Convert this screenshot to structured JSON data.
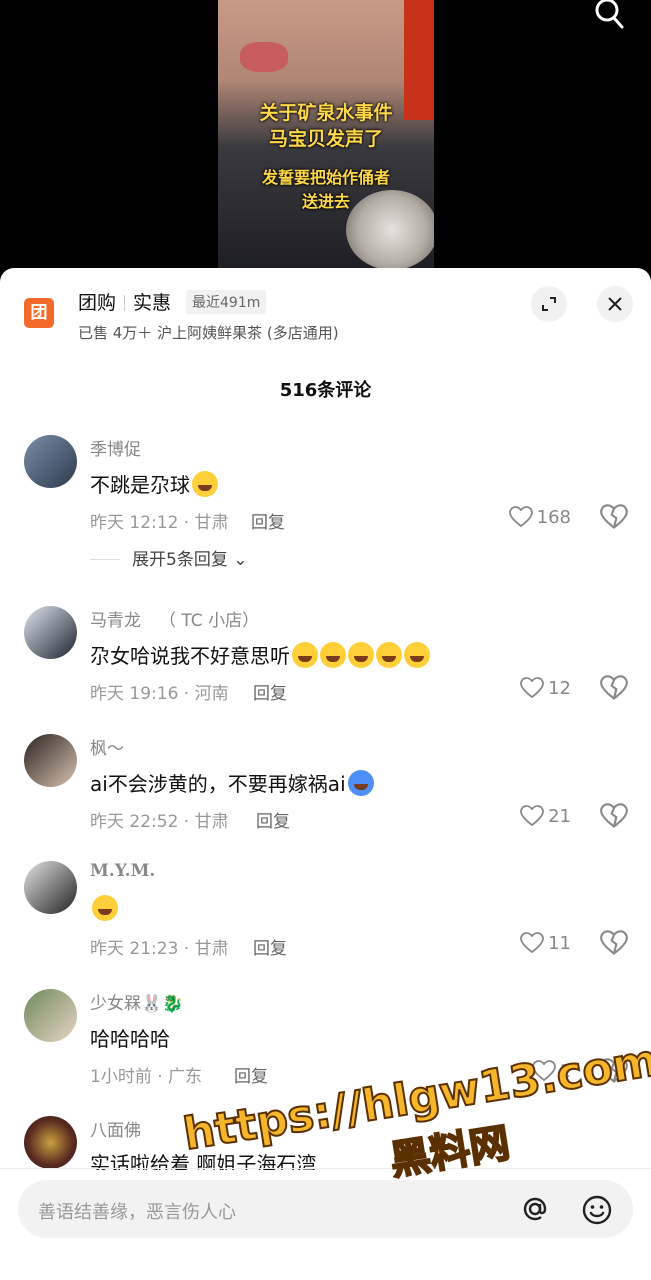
{
  "video": {
    "caption_line1": "关于矿泉水事件",
    "caption_line2": "马宝贝发声了",
    "caption_line3": "发誓要把始作俑者",
    "caption_line4": "送进去"
  },
  "groupbuy": {
    "logo": "团",
    "label1": "团购",
    "label2": "实惠",
    "distance": "最近491m",
    "subtitle": "已售 4万＋ 沪上阿姨鲜果茶 (多店通用)"
  },
  "comments_count": "516条评论",
  "reply_label": "回复",
  "comments": [
    {
      "user": "季博促",
      "tag": "",
      "text": "不跳是尕球",
      "emojis": 1,
      "time": "昨天 12:12 · 甘肃",
      "likes": "168",
      "expand": "展开5条回复"
    },
    {
      "user": "马青龙",
      "tag": "（ TC 小店）",
      "text": "尕女哈说我不好意思听",
      "emojis": 5,
      "time": "昨天 19:16 · 河南",
      "likes": "12"
    },
    {
      "user": "枫～",
      "tag": "",
      "text": "ai不会涉黄的，不要再嫁祸ai",
      "emojis": 1,
      "time": "昨天 22:52 · 甘肃",
      "likes": "21"
    },
    {
      "user": "M.Y.M.",
      "tag": "",
      "text": "",
      "emojis": 1,
      "time": "昨天 21:23 · 甘肃",
      "likes": "11"
    },
    {
      "user": "少女槑🐰🐉",
      "tag": "",
      "text": "哈哈哈哈",
      "emojis": 0,
      "time": "1小时前 · 广东",
      "likes": "1"
    },
    {
      "user": "八面佛",
      "tag": "",
      "text": "实话啦给着 啊姐子海石湾",
      "emojis": 0,
      "time": "",
      "likes": ""
    }
  ],
  "input": {
    "placeholder": "善语结善缘，恶言伤人心"
  },
  "watermark": {
    "url": "https://hlgw13.com",
    "name": "黑料网"
  },
  "colors": {
    "accent": "#f26b2a",
    "caption": "#ffd84a",
    "watermark": "#f5b62b"
  }
}
